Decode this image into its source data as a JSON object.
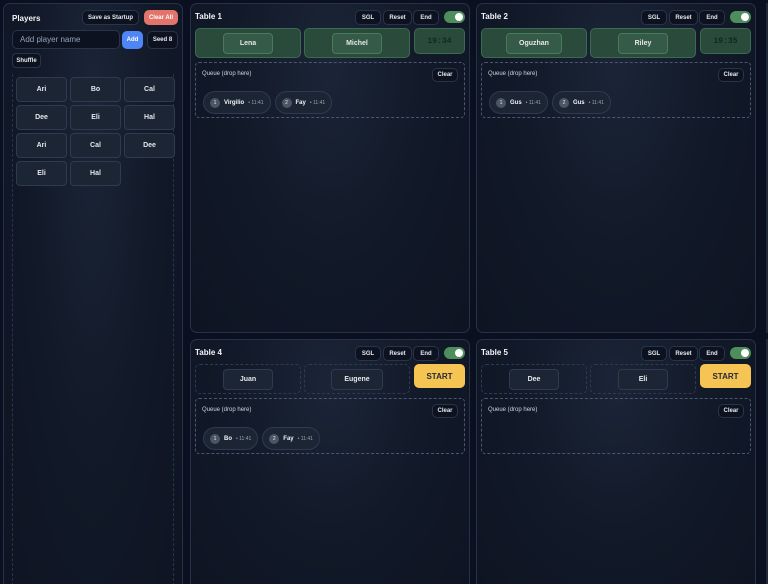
{
  "players_panel": {
    "title": "Players",
    "save_startup_label": "Save as Startup",
    "clear_all_label": "Clear All",
    "input_placeholder": "Add player name",
    "add_label": "Add",
    "seed_label": "Seed 8",
    "shuffle_label": "Shuffle",
    "pool": [
      "Ari",
      "Bo",
      "Cal",
      "Dee",
      "Eli",
      "Hal",
      "Ari",
      "Cal",
      "Dee",
      "Eli",
      "Hal"
    ]
  },
  "tables": [
    {
      "title": "Table 1",
      "sgl_label": "SGL",
      "reset_label": "Reset",
      "end_label": "End",
      "players": [
        "Lena",
        "Michel"
      ],
      "timer": "19:34",
      "queue_label": "Queue (drop here)",
      "clear_label": "Clear",
      "queue": [
        {
          "num": "1",
          "name": "Virgilio",
          "time": "• 11:41"
        },
        {
          "num": "2",
          "name": "Fay",
          "time": "• 11:41"
        }
      ]
    },
    {
      "title": "Table 2",
      "sgl_label": "SGL",
      "reset_label": "Reset",
      "end_label": "End",
      "players": [
        "Oguzhan",
        "Riley"
      ],
      "timer": "19:35",
      "queue_label": "Queue (drop here)",
      "clear_label": "Clear",
      "queue": [
        {
          "num": "1",
          "name": "Gus",
          "time": "• 11:41"
        },
        {
          "num": "2",
          "name": "Gus",
          "time": "• 11:41"
        }
      ]
    },
    {
      "title": "Table 4",
      "sgl_label": "SGL",
      "reset_label": "Reset",
      "end_label": "End",
      "players": [
        "Juan",
        "Eugene"
      ],
      "start_label": "START",
      "queue_label": "Queue (drop here)",
      "clear_label": "Clear",
      "queue": [
        {
          "num": "1",
          "name": "Bo",
          "time": "• 11:41"
        },
        {
          "num": "2",
          "name": "Fay",
          "time": "• 11:41"
        }
      ]
    },
    {
      "title": "Table 5",
      "sgl_label": "SGL",
      "reset_label": "Reset",
      "end_label": "End",
      "players": [
        "Dee",
        "Eli"
      ],
      "start_label": "START",
      "queue_label": "Queue (drop here)",
      "clear_label": "Clear",
      "queue": []
    }
  ],
  "colors": {
    "background": "#0b1020",
    "active_slot": "#2a4a3b",
    "start_button": "#f6c453",
    "clear_all": "#e2746c",
    "add_button": "#4f86f7",
    "toggle_on": "#4e8e5c"
  }
}
